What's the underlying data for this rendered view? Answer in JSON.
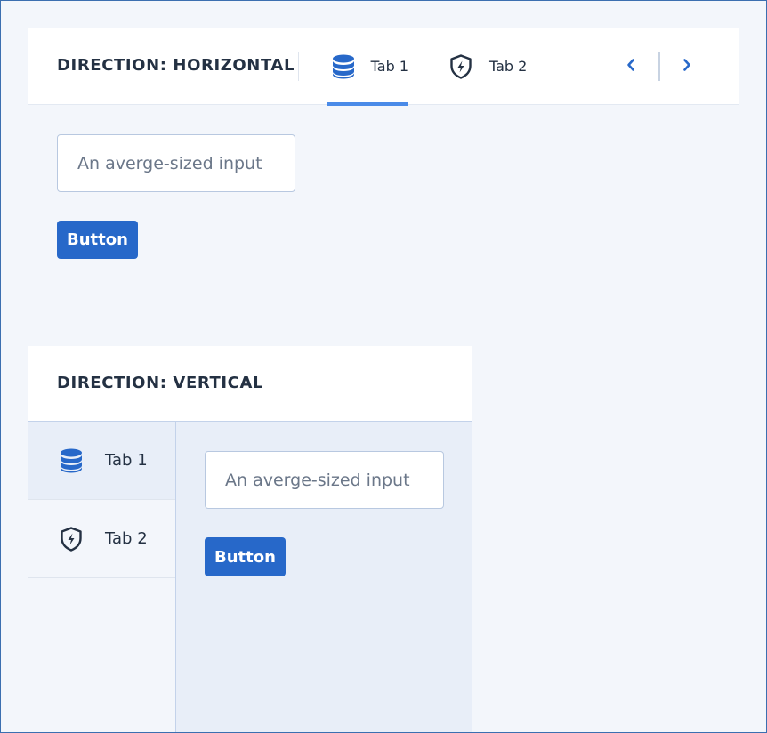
{
  "horizontal": {
    "title": "DIRECTION: HORIZONTAL",
    "tabs": [
      {
        "label": "Tab 1",
        "icon": "database-icon",
        "active": true
      },
      {
        "label": "Tab 2",
        "icon": "shield-bolt-icon",
        "active": false
      }
    ],
    "nav": {
      "prev_icon": "chevron-left-icon",
      "next_icon": "chevron-right-icon"
    },
    "input": {
      "placeholder": "An averge-sized input",
      "value": ""
    },
    "button_label": "Button"
  },
  "vertical": {
    "title": "DIRECTION: VERTICAL",
    "tabs": [
      {
        "label": "Tab 1",
        "icon": "database-icon",
        "active": true
      },
      {
        "label": "Tab 2",
        "icon": "shield-bolt-icon",
        "active": false
      }
    ],
    "input": {
      "placeholder": "An averge-sized input",
      "value": ""
    },
    "button_label": "Button"
  },
  "colors": {
    "accent": "#2768c9",
    "tab_indicator": "#4a8be8",
    "page_bg": "#f3f6fb",
    "panel_bg": "#e8eef8",
    "text": "#243143"
  }
}
